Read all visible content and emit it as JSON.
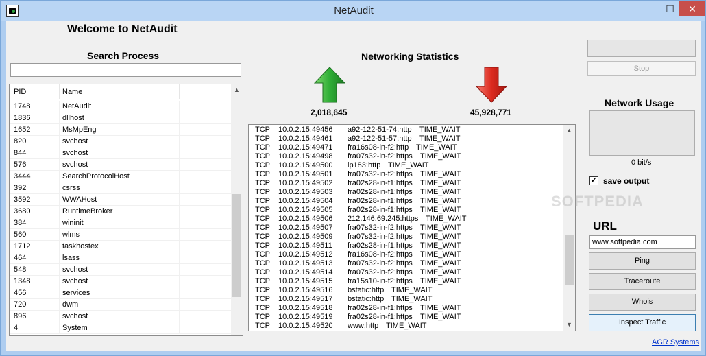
{
  "window": {
    "title": "NetAudit",
    "minimize_glyph": "—",
    "maximize_glyph": "☐",
    "close_glyph": "✕",
    "icon": "app-icon"
  },
  "welcome": "Welcome to NetAudit",
  "search": {
    "title": "Search Process",
    "value": "",
    "placeholder": ""
  },
  "process_list": {
    "columns": [
      "PID",
      "Name"
    ],
    "rows": [
      [
        "1748",
        "NetAudit"
      ],
      [
        "1836",
        "dllhost"
      ],
      [
        "1652",
        "MsMpEng"
      ],
      [
        "820",
        "svchost"
      ],
      [
        "844",
        "svchost"
      ],
      [
        "576",
        "svchost"
      ],
      [
        "3444",
        "SearchProtocolHost"
      ],
      [
        "392",
        "csrss"
      ],
      [
        "3592",
        "WWAHost"
      ],
      [
        "3680",
        "RuntimeBroker"
      ],
      [
        "384",
        "wininit"
      ],
      [
        "560",
        "wlms"
      ],
      [
        "1712",
        "taskhostex"
      ],
      [
        "464",
        "lsass"
      ],
      [
        "548",
        "svchost"
      ],
      [
        "1348",
        "svchost"
      ],
      [
        "456",
        "services"
      ],
      [
        "720",
        "dwm"
      ],
      [
        "896",
        "svchost"
      ],
      [
        "4",
        "System"
      ]
    ]
  },
  "stats": {
    "title": "Networking Statistics",
    "sent": "2,018,645",
    "received": "45,928,771",
    "sent_icon": "arrow-up-icon",
    "received_icon": "arrow-down-icon",
    "sent_color": "#2e9e3a",
    "received_color": "#d42a1e"
  },
  "connections": [
    [
      "TCP",
      "10.0.2.15:49456",
      "a92-122-51-74:http",
      "TIME_WAIT"
    ],
    [
      "TCP",
      "10.0.2.15:49461",
      "a92-122-51-57:http",
      "TIME_WAIT"
    ],
    [
      "TCP",
      "10.0.2.15:49471",
      "fra16s08-in-f2:http",
      "TIME_WAIT"
    ],
    [
      "TCP",
      "10.0.2.15:49498",
      "fra07s32-in-f2:https",
      "TIME_WAIT"
    ],
    [
      "TCP",
      "10.0.2.15:49500",
      "ip183:http",
      "TIME_WAIT"
    ],
    [
      "TCP",
      "10.0.2.15:49501",
      "fra07s32-in-f2:https",
      "TIME_WAIT"
    ],
    [
      "TCP",
      "10.0.2.15:49502",
      "fra02s28-in-f1:https",
      "TIME_WAIT"
    ],
    [
      "TCP",
      "10.0.2.15:49503",
      "fra02s28-in-f1:https",
      "TIME_WAIT"
    ],
    [
      "TCP",
      "10.0.2.15:49504",
      "fra02s28-in-f1:https",
      "TIME_WAIT"
    ],
    [
      "TCP",
      "10.0.2.15:49505",
      "fra02s28-in-f1:https",
      "TIME_WAIT"
    ],
    [
      "TCP",
      "10.0.2.15:49506",
      "212.146.69.245:https",
      "TIME_WAIT"
    ],
    [
      "TCP",
      "10.0.2.15:49507",
      "fra07s32-in-f2:https",
      "TIME_WAIT"
    ],
    [
      "TCP",
      "10.0.2.15:49509",
      "fra07s32-in-f2:https",
      "TIME_WAIT"
    ],
    [
      "TCP",
      "10.0.2.15:49511",
      "fra02s28-in-f1:https",
      "TIME_WAIT"
    ],
    [
      "TCP",
      "10.0.2.15:49512",
      "fra16s08-in-f2:https",
      "TIME_WAIT"
    ],
    [
      "TCP",
      "10.0.2.15:49513",
      "fra07s32-in-f2:https",
      "TIME_WAIT"
    ],
    [
      "TCP",
      "10.0.2.15:49514",
      "fra07s32-in-f2:https",
      "TIME_WAIT"
    ],
    [
      "TCP",
      "10.0.2.15:49515",
      "fra15s10-in-f2:https",
      "TIME_WAIT"
    ],
    [
      "TCP",
      "10.0.2.15:49516",
      "bstatic:http",
      "TIME_WAIT"
    ],
    [
      "TCP",
      "10.0.2.15:49517",
      "bstatic:http",
      "TIME_WAIT"
    ],
    [
      "TCP",
      "10.0.2.15:49518",
      "fra02s28-in-f1:https",
      "TIME_WAIT"
    ],
    [
      "TCP",
      "10.0.2.15:49519",
      "fra02s28-in-f1:https",
      "TIME_WAIT"
    ],
    [
      "TCP",
      "10.0.2.15:49520",
      "www:http",
      "TIME_WAIT"
    ]
  ],
  "side": {
    "stop_label": "Stop",
    "usage_title": "Network Usage",
    "bitrate": "0 bit/s",
    "save_output_label": "save output",
    "save_output_checked": true,
    "check_glyph": "✓",
    "url_title": "URL",
    "url_value": "www.softpedia.com",
    "ping_label": "Ping",
    "traceroute_label": "Traceroute",
    "whois_label": "Whois",
    "inspect_label": "Inspect Traffic",
    "agr_link": "AGR Systems"
  },
  "watermark": "SOFTPEDIA",
  "scroll_glyphs": {
    "up": "▲",
    "down": "▼"
  }
}
